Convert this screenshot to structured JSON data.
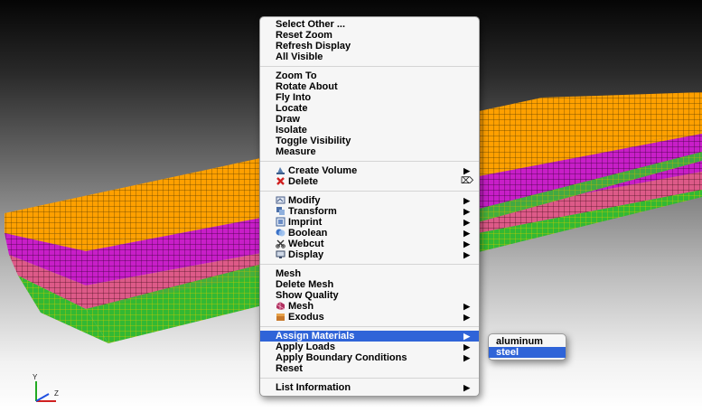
{
  "viewport": {
    "colors": {
      "top_face": "#ffa500",
      "mid_layer": "#cc22cc",
      "pink_layer": "#e05a8a",
      "bottom_layer": "#33bb33"
    }
  },
  "context_menu": {
    "groups": [
      {
        "items": [
          {
            "label": "Select Other ..."
          },
          {
            "label": "Reset Zoom"
          },
          {
            "label": "Refresh Display"
          },
          {
            "label": "All Visible"
          }
        ]
      },
      {
        "items": [
          {
            "label": "Zoom To"
          },
          {
            "label": "Rotate About"
          },
          {
            "label": "Fly Into"
          },
          {
            "label": "Locate"
          },
          {
            "label": "Draw"
          },
          {
            "label": "Isolate"
          },
          {
            "label": "Toggle Visibility"
          },
          {
            "label": "Measure"
          }
        ]
      },
      {
        "items": [
          {
            "label": "Create Volume",
            "icon": "create-volume-icon",
            "submenu": true
          },
          {
            "label": "Delete",
            "icon": "delete-icon",
            "shortcut": "⌦"
          }
        ]
      },
      {
        "items": [
          {
            "label": "Modify",
            "icon": "modify-icon",
            "submenu": true
          },
          {
            "label": "Transform",
            "icon": "transform-icon",
            "submenu": true
          },
          {
            "label": "Imprint",
            "icon": "imprint-icon",
            "submenu": true
          },
          {
            "label": "Boolean",
            "icon": "boolean-icon",
            "submenu": true
          },
          {
            "label": "Webcut",
            "icon": "webcut-icon",
            "submenu": true
          },
          {
            "label": "Display",
            "icon": "display-icon",
            "submenu": true
          }
        ]
      },
      {
        "items": [
          {
            "label": "Mesh"
          },
          {
            "label": "Delete Mesh"
          },
          {
            "label": "Show Quality"
          },
          {
            "label": "Mesh",
            "icon": "mesh-icon",
            "submenu": true
          },
          {
            "label": "Exodus",
            "icon": "exodus-icon",
            "submenu": true
          }
        ]
      },
      {
        "items": [
          {
            "label": "Assign Materials",
            "submenu": true,
            "selected": true
          },
          {
            "label": "Apply Loads",
            "submenu": true
          },
          {
            "label": "Apply Boundary Conditions",
            "submenu": true
          },
          {
            "label": "Reset"
          }
        ]
      },
      {
        "items": [
          {
            "label": "List Information",
            "submenu": true
          }
        ]
      }
    ]
  },
  "submenu": {
    "items": [
      {
        "label": "aluminum"
      },
      {
        "label": "steel",
        "selected": true
      }
    ]
  },
  "axis_triad": {
    "y_label": "Y",
    "z_label": "Z"
  }
}
